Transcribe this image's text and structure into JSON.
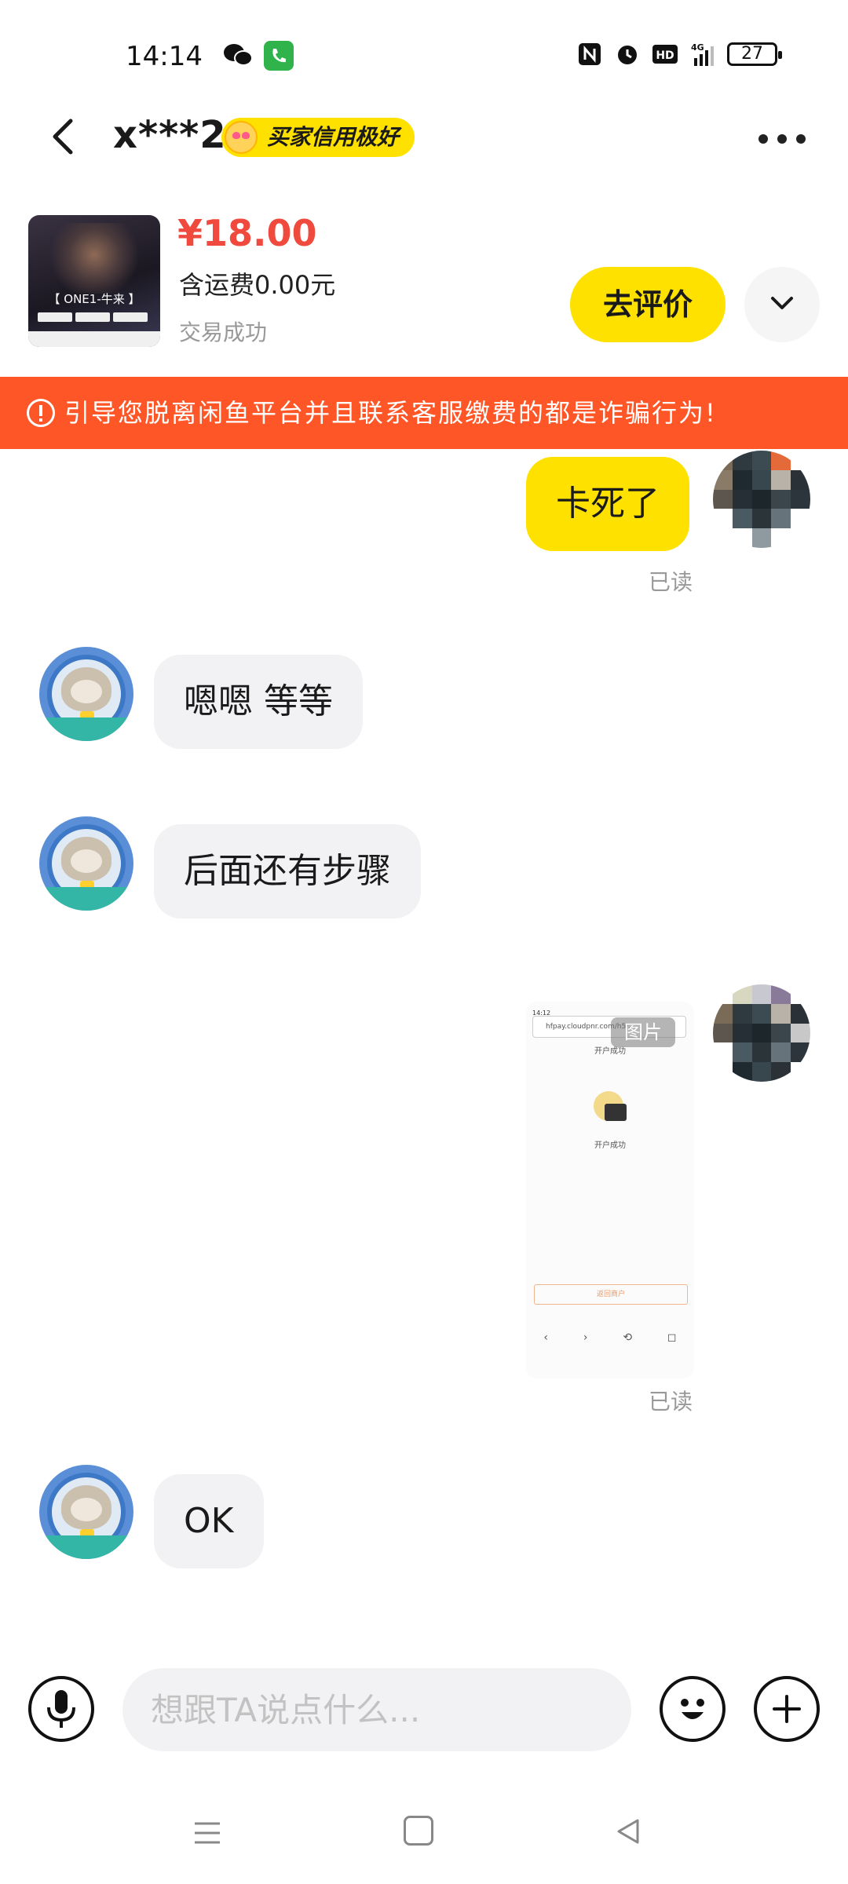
{
  "status_bar": {
    "time": "14:14",
    "network": "4G",
    "battery": "27"
  },
  "header": {
    "title": "x***2",
    "badge": "买家信用极好"
  },
  "product": {
    "thumb_title": "【 ONE1-牛来 】",
    "price": "¥18.00",
    "shipping": "含运费0.00元",
    "status": "交易成功",
    "review_button": "去评价"
  },
  "warning": {
    "text": "引导您脱离闲鱼平台并且联系客服缴费的都是诈骗行为!"
  },
  "messages": [
    {
      "from": "me",
      "text": "卡死了",
      "read": "已读"
    },
    {
      "from": "other",
      "text": "嗯嗯  等等"
    },
    {
      "from": "other",
      "text": "后面还有步骤"
    },
    {
      "from": "me",
      "type": "image",
      "image_tag": "图片",
      "image_time": "14:12",
      "image_url": "hfpay.cloudpnr.com/h5/...",
      "image_header": "开户成功",
      "image_success": "开户成功",
      "image_button": "返回商户",
      "read": "已读"
    },
    {
      "from": "other",
      "text": "OK"
    }
  ],
  "input_bar": {
    "placeholder": "想跟TA说点什么..."
  },
  "colors": {
    "accent_yellow": "#ffe100",
    "warning_orange": "#ff5627",
    "price_red": "#f0493e"
  },
  "icons": [
    "back-icon",
    "more-icon",
    "chevron-down-icon",
    "warning-icon",
    "microphone-icon",
    "emoji-icon",
    "plus-icon",
    "menu-icon",
    "home-icon",
    "back-triangle-icon"
  ]
}
